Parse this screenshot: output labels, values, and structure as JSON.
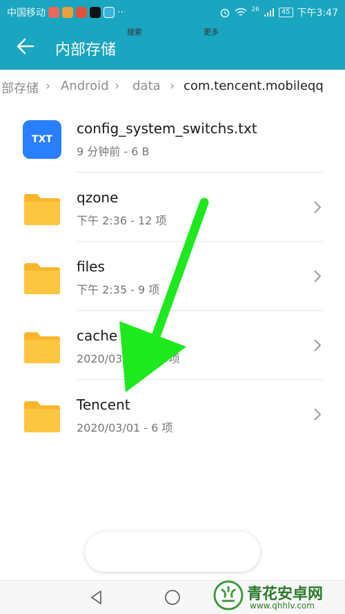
{
  "status_bar": {
    "carrier": "中国移动",
    "more": "···",
    "battery": "45",
    "time": "下午3:47",
    "signal_label": "26"
  },
  "header": {
    "title": "内部存储"
  },
  "breadcrumb": {
    "items": [
      "部存储",
      "Android",
      "data"
    ],
    "current": "com.tencent.mobileqq"
  },
  "files": [
    {
      "name": "config_system_switchs.txt",
      "meta": "9 分钟前 - 6 B",
      "type": "txt",
      "badge": "TXT"
    },
    {
      "name": "qzone",
      "meta": "下午 2:36  - 12 项",
      "type": "folder"
    },
    {
      "name": "files",
      "meta": "下午 2:35  - 9 项",
      "type": "folder"
    },
    {
      "name": "cache",
      "meta": "2020/03/01 - 10 项",
      "type": "folder"
    },
    {
      "name": "Tencent",
      "meta": "2020/03/01 - 6 项",
      "type": "folder"
    }
  ],
  "toolbar": {
    "search_label": "搜索",
    "more_label": "更多"
  },
  "watermark": {
    "text": "青花安卓网",
    "url": "www.qhhlv.com"
  },
  "colors": {
    "header": "#1aa5c0",
    "folder": "#fbb52a",
    "txt_icon": "#2a7fff",
    "annotation_arrow": "#1ee81e"
  }
}
